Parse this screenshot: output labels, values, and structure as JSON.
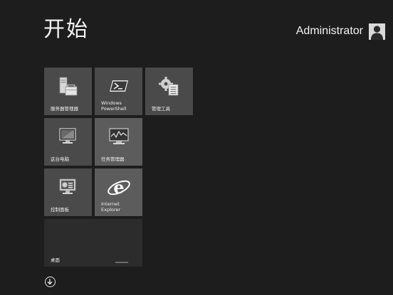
{
  "start": {
    "title": "开始"
  },
  "user": {
    "name": "Administrator",
    "avatar_icon": "user-icon"
  },
  "tiles": [
    {
      "label": "服务器管理器",
      "icon": "server-manager-icon"
    },
    {
      "label": "Windows\nPowerShell",
      "icon": "powershell-icon"
    },
    {
      "label": "管理工具",
      "icon": "admin-tools-icon"
    },
    {
      "label": "这台电脑",
      "icon": "computer-icon"
    },
    {
      "label": "任务管理器",
      "icon": "task-manager-icon"
    },
    {
      "label": "控制面板",
      "icon": "control-panel-icon"
    },
    {
      "label": "Internet\nExplorer",
      "icon": "internet-explorer-icon"
    },
    {
      "label": "桌面",
      "icon": "desktop-icon"
    }
  ],
  "apps_button": {
    "icon": "down-arrow-icon"
  },
  "colors": {
    "background": "#1d1d1d",
    "tile": "#4a4a4a",
    "tile_desktop": "#2c2c2c",
    "text": "#ffffff"
  }
}
